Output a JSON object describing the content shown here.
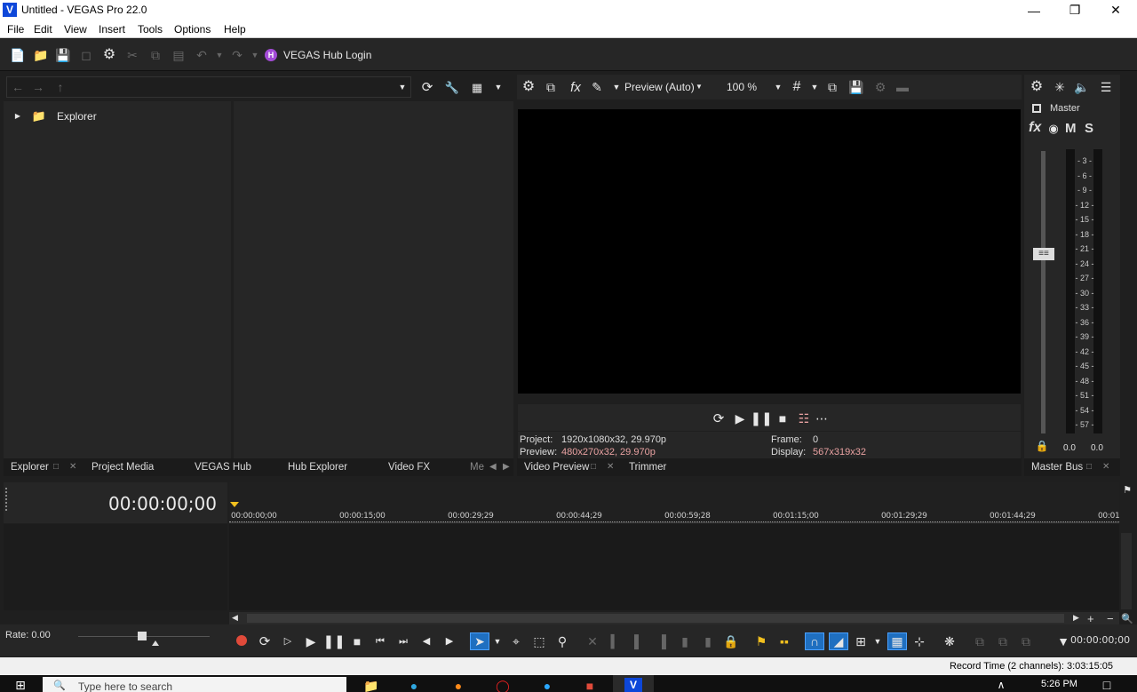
{
  "window": {
    "title": "Untitled - VEGAS Pro 22.0",
    "app_icon": "V"
  },
  "menu": [
    "File",
    "Edit",
    "View",
    "Insert",
    "Tools",
    "Options",
    "Help"
  ],
  "toolbar": {
    "hub_icon": "H",
    "hub_login": "VEGAS Hub Login"
  },
  "explorer": {
    "root": "Explorer"
  },
  "preview": {
    "mode": "Preview (Auto)",
    "zoom": "100 %",
    "project_label": "Project:",
    "project_value": "1920x1080x32, 29.970p",
    "preview_label": "Preview:",
    "preview_value": "480x270x32, 29.970p",
    "frame_label": "Frame:",
    "frame_value": "0",
    "display_label": "Display:",
    "display_value": "567x319x32"
  },
  "master": {
    "label": "Master",
    "fx": "fx",
    "m": "M",
    "s": "S",
    "scale": [
      "3",
      "6",
      "9",
      "12",
      "15",
      "18",
      "21",
      "24",
      "27",
      "30",
      "33",
      "36",
      "39",
      "42",
      "45",
      "48",
      "51",
      "54",
      "57"
    ],
    "left_level": "0.0",
    "right_level": "0.0"
  },
  "tabs_left": [
    "Explorer",
    "Project Media",
    "VEGAS Hub",
    "Hub Explorer",
    "Video FX",
    "Me"
  ],
  "tabs_mid": [
    "Video Preview",
    "Trimmer"
  ],
  "tabs_right": [
    "Master Bus"
  ],
  "timeline": {
    "timecode": "00:00:00;00",
    "ruler": [
      "00:00:00;00",
      "00:00:15;00",
      "00:00:29;29",
      "00:00:44;29",
      "00:00:59;28",
      "00:01:15;00",
      "00:01:29;29",
      "00:01:44;29",
      "00:01"
    ]
  },
  "rate": "Rate: 0.00",
  "transport": {
    "cursor_time": "00:00:00;00"
  },
  "status": "Record Time (2 channels): 3:03:15:05",
  "taskbar": {
    "search": "Type here to search",
    "time": "5:26 PM"
  },
  "colors": {
    "accent_pink": "#e8a1a1",
    "hub_purple": "#a34bd6",
    "record_red": "#e04a3a",
    "marker_yellow": "#f2c01e"
  }
}
